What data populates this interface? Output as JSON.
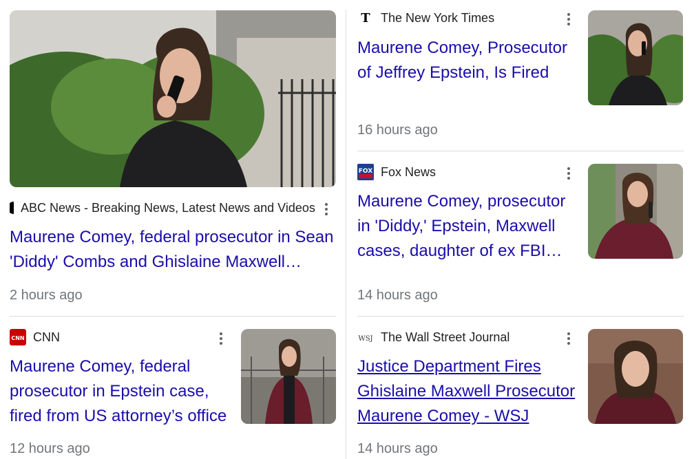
{
  "cards": [
    {
      "source": "ABC News - Breaking News, Latest News and Videos",
      "logo": "abc-logo-icon",
      "headline": "Maurene Comey, federal prosecutor in Sean 'Diddy' Combs and Ghislaine Maxwell…",
      "time": "2 hours ago"
    },
    {
      "source": "The New York Times",
      "logo": "nyt-logo-icon",
      "headline": "Maurene Comey, Prosecutor of Jeffrey Epstein, Is Fired",
      "time": "16 hours ago"
    },
    {
      "source": "Fox News",
      "logo": "fox-news-logo-icon",
      "headline": "Maurene Comey, prosecutor in 'Diddy,' Epstein, Maxwell cases, daughter of ex FBI…",
      "time": "14 hours ago"
    },
    {
      "source": "CNN",
      "logo": "cnn-logo-icon",
      "logo_text": "CNN",
      "headline": "Maurene Comey, federal prosecutor in Epstein case, fired from US attorney’s office",
      "time": "12 hours ago"
    },
    {
      "source": "The Wall Street Journal",
      "logo": "wsj-logo-icon",
      "logo_text": "WSJ",
      "headline": "Justice Department Fires Ghislaine Maxwell Prosecutor Maurene Comey - WSJ",
      "time": "14 hours ago"
    }
  ],
  "colors": {
    "headline": "#1a0dab",
    "meta": "#70757a",
    "divider": "#dadce0",
    "cnn_red": "#cc0000",
    "fox_blue": "#1c3f8f"
  }
}
